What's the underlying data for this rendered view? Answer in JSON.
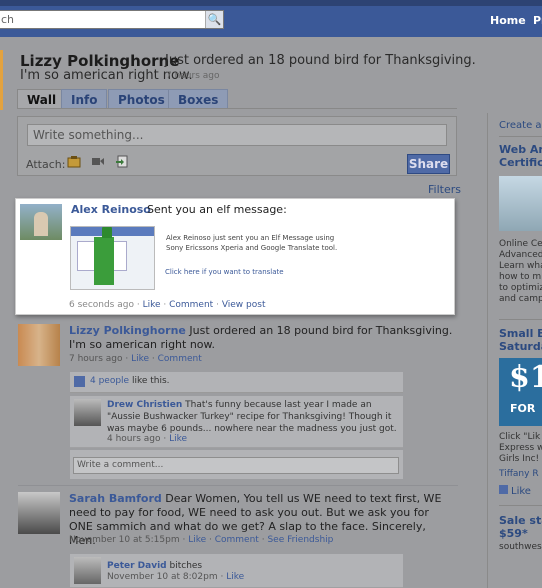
{
  "topbar": {
    "search_placeholder": "ch",
    "search_button": "🔍",
    "nav_home": "Home",
    "nav_profile": "Pr"
  },
  "profile": {
    "name": "Lizzy Polkinghorne",
    "status_line1": "Just ordered an 18 pound bird for Thanksgiving.",
    "status_line2": "I'm so american right now.",
    "status_time": "7 hours ago"
  },
  "tabs": [
    "Wall",
    "Info",
    "Photos",
    "Boxes"
  ],
  "publisher": {
    "placeholder": "Write something...",
    "attach_label": "Attach:",
    "share_label": "Share"
  },
  "filters_label": "Filters",
  "elf_post": {
    "author": "Alex Reinoso",
    "message": "Sent you an elf message:",
    "description": "Alex Reinoso just sent you an Elf Message using Sony Ericssons Xperia and Google Translate tool.",
    "translate_link": "Click here if you want to translate",
    "time": "6 seconds ago",
    "actions": [
      "Like",
      "Comment",
      "View post"
    ]
  },
  "post1": {
    "author": "Lizzy Polkinghorne",
    "text_line1": "Just ordered an 18 pound bird for Thanksgiving.",
    "text_line2": "I'm so american right now.",
    "time": "7 hours ago",
    "actions": [
      "Like",
      "Comment"
    ],
    "likes_count": "4 people",
    "likes_suffix": "like this.",
    "comment": {
      "author": "Drew Christien",
      "text": "That's funny because last year I made an \"Aussie Bushwacker Turkey\" recipe for Thanksgiving! Though it was maybe 6 pounds... nowhere near the madness you just got.",
      "time": "4 hours ago",
      "action": "Like"
    },
    "write_comment_placeholder": "Write a comment..."
  },
  "post2": {
    "author": "Sarah Bamford",
    "text": "Dear Women, You tell us WE need to text first, WE need to pay for food, WE need to ask you out. But we ask you for ONE sammich and what do we get? A slap to the face. Sincerely, Men.",
    "time": "November 10 at 5:15pm",
    "actions": [
      "Like",
      "Comment",
      "See Friendship"
    ],
    "comment": {
      "author": "Peter David",
      "text": "bitches",
      "time": "November 10 at 8:02pm",
      "action": "Like"
    }
  },
  "sidebar": {
    "create_ad": "Create an",
    "ad1_title_1": "Web Ana",
    "ad1_title_2": "Certifica",
    "ad1_body": [
      "Online Ce",
      "Advanced",
      "Learn wha",
      "how to m",
      "to optimiz",
      "and camp"
    ],
    "ad2_title_1": "Small Bu",
    "ad2_title_2": "Saturday",
    "ad2_img_text": "$1",
    "ad2_img_sub": "FOR",
    "ad2_body": [
      "Click \"Lik",
      "Express w",
      "Girls Inc!"
    ],
    "ad2_brand": "Tiffany R",
    "ad2_like": "Like",
    "ad3_title_1": "Sale star",
    "ad3_title_2": "$59*",
    "ad3_body": "southwes"
  },
  "colors": {
    "brand_blue": "#3b5998",
    "link_blue": "#3b5998",
    "share_button": "#4f6aa6"
  }
}
